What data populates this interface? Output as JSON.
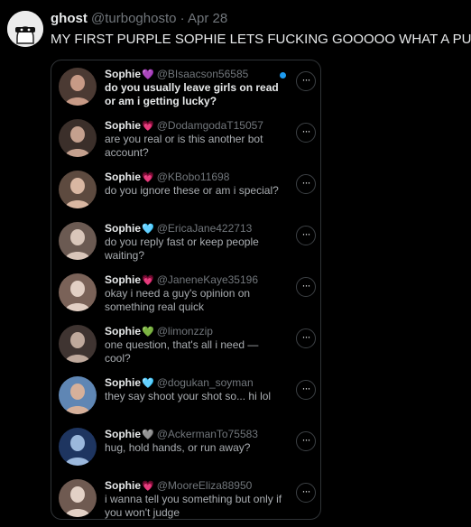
{
  "post": {
    "author_name": "ghost",
    "author_handle": "@turboghosto",
    "date": "Apr 28",
    "text": "MY FIRST PURPLE SOPHIE LETS FUCKING GOOOOO WHAT A PULL"
  },
  "messages": [
    {
      "name": "Sophie",
      "heart": "💜",
      "heart_color": "#a855f7",
      "handle": "@BIsaacson56585",
      "text": "do you usually leave girls on read or am i getting lucky?",
      "unread": true,
      "avatar_colors": [
        "#c79a86",
        "#4b3a33"
      ]
    },
    {
      "name": "Sophie",
      "heart": "💗",
      "heart_color": "#ff5fa8",
      "handle": "@DodamgodaT15057",
      "text": "are you real or is this another bot account?",
      "unread": false,
      "avatar_colors": [
        "#c4a08e",
        "#3b2f2a"
      ]
    },
    {
      "name": "Sophie",
      "heart": "💗",
      "heart_color": "#ff5fa8",
      "handle": "@KBobo11698",
      "text": "do you ignore these or am i special?",
      "unread": false,
      "avatar_colors": [
        "#d9b7a2",
        "#5d4a3f"
      ]
    },
    {
      "name": "Sophie",
      "heart": "🩵",
      "heart_color": "#5fd0ff",
      "handle": "@EricaJane422713",
      "text": "do you reply fast or keep people waiting?",
      "unread": false,
      "avatar_colors": [
        "#d9c6ba",
        "#6b5a52"
      ]
    },
    {
      "name": "Sophie",
      "heart": "💗",
      "heart_color": "#ff5fa8",
      "handle": "@JaneneKaye35196",
      "text": "okay i need a guy's opinion on something real quick",
      "unread": false,
      "avatar_colors": [
        "#e2cfc4",
        "#7a6258"
      ]
    },
    {
      "name": "Sophie",
      "heart": "💚",
      "heart_color": "#3ecf5a",
      "handle": "@limonzzip",
      "text": "one question, that's all i need — cool?",
      "unread": false,
      "avatar_colors": [
        "#bfa99c",
        "#3f3431"
      ]
    },
    {
      "name": "Sophie",
      "heart": "🩵",
      "heart_color": "#5fd0ff",
      "handle": "@dogukan_soyman",
      "text": "they say shoot your shot so... hi lol",
      "unread": false,
      "avatar_colors": [
        "#d6b09a",
        "#5f86b4"
      ]
    },
    {
      "name": "Sophie",
      "heart": "🩶",
      "heart_color": "#bfbfbf",
      "handle": "@AckermanTo75583",
      "text": "hug, hold hands, or run away?",
      "unread": false,
      "avatar_colors": [
        "#9bb8dc",
        "#1e3560"
      ]
    },
    {
      "name": "Sophie",
      "heart": "💗",
      "heart_color": "#ff5fa8",
      "handle": "@MooreEliza88950",
      "text": "i wanna tell you something but only if you won't judge",
      "unread": false,
      "avatar_colors": [
        "#e3d1c6",
        "#6f5a51"
      ]
    }
  ],
  "more_glyph": "···"
}
